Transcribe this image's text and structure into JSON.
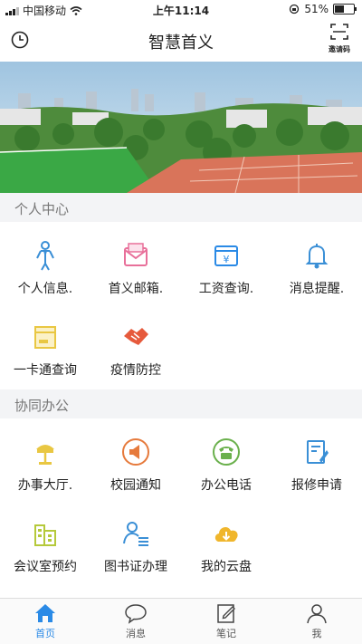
{
  "status_bar": {
    "carrier": "中国移动",
    "time": "上午11:14",
    "battery": "51%",
    "battery_level": 0.51
  },
  "header": {
    "title": "智慧首义",
    "invite_label": "邀请码"
  },
  "sections": [
    {
      "title": "个人中心",
      "items": [
        {
          "label": "个人信息.",
          "icon": "person-icon",
          "color": "#3a8fd6"
        },
        {
          "label": "首义邮箱.",
          "icon": "mail-icon",
          "color": "#e8709a"
        },
        {
          "label": "工资查询.",
          "icon": "salary-icon",
          "color": "#2a8ae6"
        },
        {
          "label": "消息提醒.",
          "icon": "bell-icon",
          "color": "#3a8fd6"
        },
        {
          "label": "一卡通查询",
          "icon": "card-icon",
          "color": "#e9c742"
        },
        {
          "label": "疫情防控",
          "icon": "handshake-icon",
          "color": "#e65a3c"
        }
      ]
    },
    {
      "title": "协同办公",
      "items": [
        {
          "label": "办事大厅.",
          "icon": "lamp-icon",
          "color": "#e9c742"
        },
        {
          "label": "校园通知",
          "icon": "megaphone-icon",
          "color": "#e67a3c"
        },
        {
          "label": "办公电话",
          "icon": "phone-icon",
          "color": "#6ab04c"
        },
        {
          "label": "报修申请",
          "icon": "repair-icon",
          "color": "#3a8fd6"
        },
        {
          "label": "会议室预约",
          "icon": "building-icon",
          "color": "#b5c93a"
        },
        {
          "label": "图书证办理",
          "icon": "library-card-icon",
          "color": "#3a8fd6"
        },
        {
          "label": "我的云盘",
          "icon": "cloud-icon",
          "color": "#f0b62c"
        }
      ]
    }
  ],
  "tabbar": [
    {
      "label": "首页",
      "icon": "home-icon",
      "active": true
    },
    {
      "label": "消息",
      "icon": "message-icon",
      "active": false
    },
    {
      "label": "笔记",
      "icon": "note-icon",
      "active": false
    },
    {
      "label": "我",
      "icon": "profile-icon",
      "active": false
    }
  ]
}
